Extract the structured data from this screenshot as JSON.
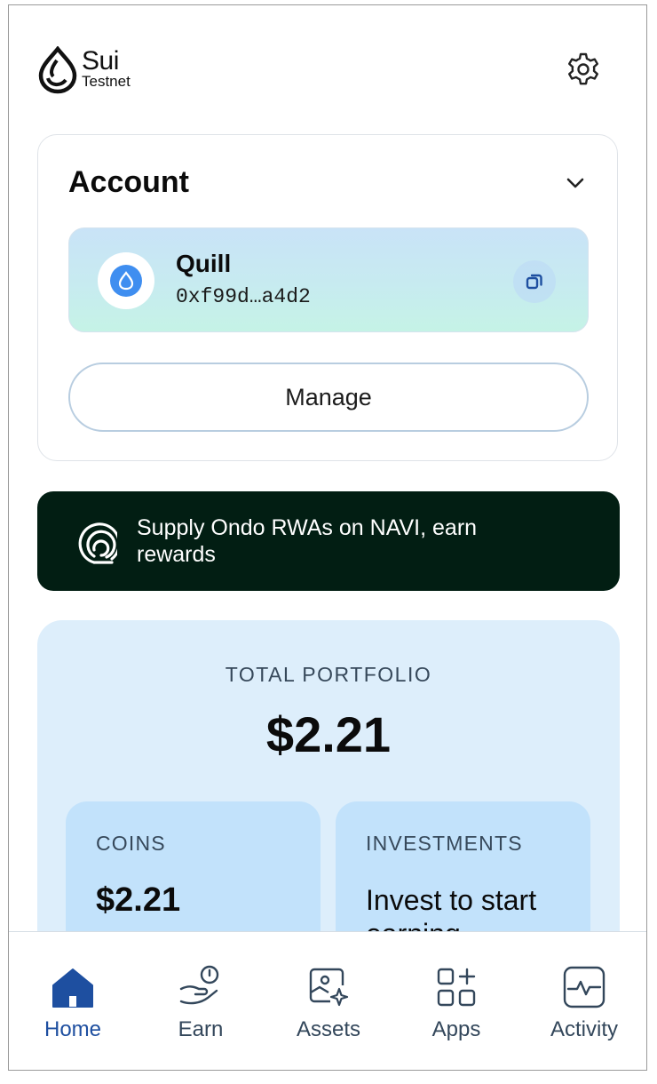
{
  "header": {
    "logo_name": "Sui",
    "network": "Testnet",
    "settings_icon": "gear-icon"
  },
  "account": {
    "title": "Account",
    "wallet_name": "Quill",
    "wallet_address": "0xf99d…a4d2",
    "manage_label": "Manage"
  },
  "promo": {
    "text": "Supply Ondo RWAs on NAVI, earn rewards"
  },
  "portfolio": {
    "label": "TOTAL PORTFOLIO",
    "value": "$2.21",
    "coins_label": "COINS",
    "coins_value": "$2.21",
    "investments_label": "INVESTMENTS",
    "investments_text": "Invest to start earning"
  },
  "nav": {
    "items": [
      {
        "label": "Home",
        "icon": "home-icon",
        "active": true
      },
      {
        "label": "Earn",
        "icon": "earn-icon",
        "active": false
      },
      {
        "label": "Assets",
        "icon": "assets-icon",
        "active": false
      },
      {
        "label": "Apps",
        "icon": "apps-icon",
        "active": false
      },
      {
        "label": "Activity",
        "icon": "activity-icon",
        "active": false
      }
    ]
  },
  "colors": {
    "promo_bg": "#021e13",
    "portfolio_bg": "#ddeefb",
    "subcard_bg": "#c2e2fb",
    "active_nav": "#1e4fa0"
  }
}
